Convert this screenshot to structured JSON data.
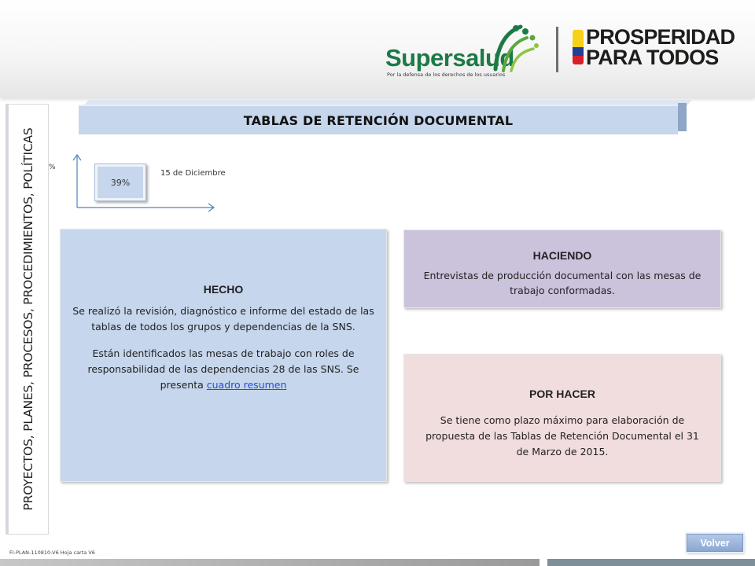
{
  "header": {
    "supersalud": {
      "wordmark": "Supersalud",
      "tagline": "Por la defensa de los derechos de los usuarios"
    },
    "prosperidad": {
      "line1": "PROSPERIDAD",
      "line2": "PARA TODOS"
    }
  },
  "sidebar": {
    "label": "PROYECTOS, PLANES, PROCESOS, PROCEDIMIENTOS, POLÍTICAS"
  },
  "title": "TABLAS DE RETENCIÓN DOCUMENTAL",
  "progress": {
    "axis_unit": "%",
    "value_label": "39%",
    "value": 39,
    "date_label": "15 de Diciembre"
  },
  "cards": {
    "hecho": {
      "heading": "HECHO",
      "text1": "Se realizó la revisión, diagnóstico e informe del estado de las tablas de todos los grupos y dependencias de la SNS.",
      "text2_prefix": "Están identificados las mesas de trabajo con roles de responsabilidad de las dependencias 28 de las SNS. Se presenta ",
      "link": "cuadro resumen"
    },
    "haciendo": {
      "heading": "HACIENDO",
      "text": "Entrevistas de producción documental con las mesas de trabajo conformadas."
    },
    "por_hacer": {
      "heading": "POR HACER",
      "text": "Se tiene como plazo máximo para elaboración de propuesta de las Tablas de Retención Documental el 31 de Marzo de 2015."
    }
  },
  "footer": {
    "code": "FI-PLAN-110810-V6 Hoja carta V6",
    "back_button": "Volver"
  },
  "colors": {
    "hecho_bg": "#c6d6ec",
    "haciendo_bg": "#cbc2dc",
    "por_hacer_bg": "#f1dddd",
    "supersalud_green": "#1c7a45",
    "flag_yellow": "#f7d117",
    "flag_blue": "#1f3f94",
    "flag_red": "#d81e2a"
  }
}
